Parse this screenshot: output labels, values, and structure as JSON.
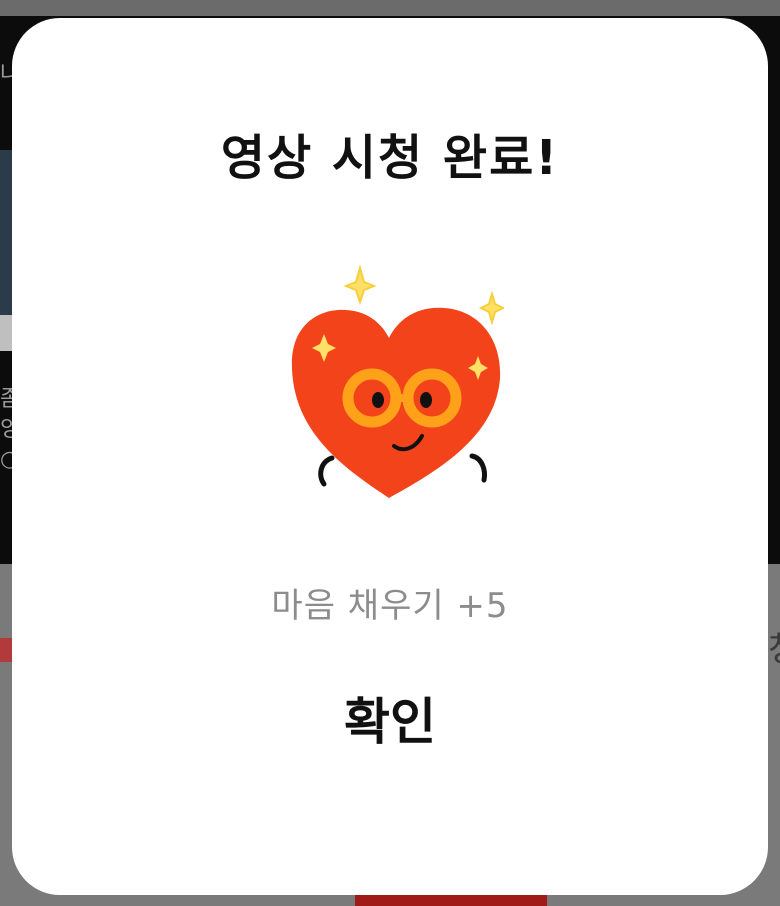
{
  "dialog": {
    "title": "영상 시청 완료!",
    "reward_text": "마음 채우기 +5",
    "confirm_label": "확인",
    "mascot_icon": "heart-with-glasses-icon"
  },
  "background": {
    "left_text_top": "나",
    "left_text_lower": "좀 잉 ○",
    "right_text": "청"
  },
  "colors": {
    "heart": "#f2431a",
    "glasses": "#ffa21a",
    "sparkle": "#ffe066",
    "dim_overlay": "#777777"
  }
}
